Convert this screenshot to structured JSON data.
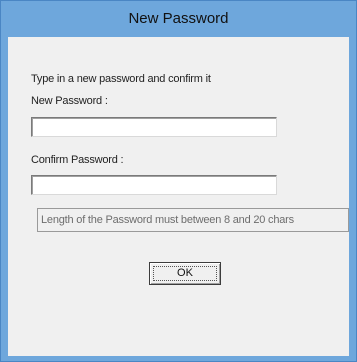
{
  "window": {
    "title": "New Password"
  },
  "dialog": {
    "instruction": "Type in a new password and confirm it",
    "new_password_label": "New Password :",
    "new_password_value": "",
    "confirm_password_label": "Confirm Password :",
    "confirm_password_value": "",
    "info_message": "Length of the Password must between 8 and 20 chars",
    "ok_label": "OK"
  },
  "colors": {
    "titlebar": "#6ea7dc",
    "client_background": "#f0f0f0",
    "info_text": "#6d6d6d"
  }
}
